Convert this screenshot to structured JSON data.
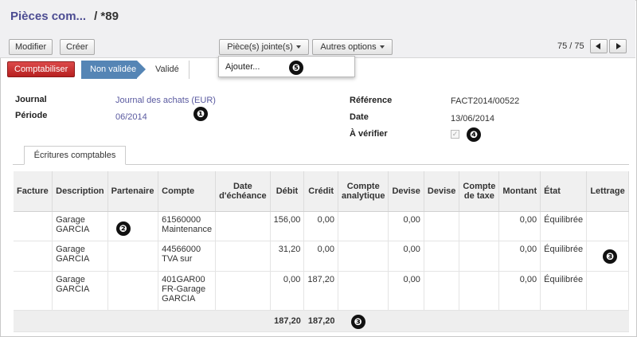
{
  "header": {
    "breadcrumb_parent": "Pièces com...",
    "breadcrumb_current": "/ *89"
  },
  "toolbar": {
    "modify_label": "Modifier",
    "create_label": "Créer",
    "attachments_label": "Pièce(s) jointe(s)",
    "more_options_label": "Autres options",
    "pager_text": "75 / 75"
  },
  "statusbar": {
    "post_label": "Comptabiliser",
    "stage_current": "Non validée",
    "stage_next": "Validé"
  },
  "dropdown": {
    "add_label": "Ajouter..."
  },
  "form": {
    "journal_label": "Journal",
    "journal_value": "Journal des achats (EUR)",
    "period_label": "Période",
    "period_value": "06/2014",
    "reference_label": "Référence",
    "reference_value": "FACT2014/00522",
    "date_label": "Date",
    "date_value": "13/06/2014",
    "to_check_label": "À vérifier",
    "to_check_value": true
  },
  "tabs": {
    "entries_label": "Écritures comptables"
  },
  "table": {
    "headers": {
      "invoice": "Facture",
      "description": "Description",
      "partner": "Partenaire",
      "account": "Compte",
      "due_date": "Date d'échéance",
      "debit": "Débit",
      "credit": "Crédit",
      "analytic": "Compte analytique",
      "currency_amount": "Devise",
      "currency": "Devise",
      "tax_account": "Compte de taxe",
      "amount": "Montant",
      "state": "État",
      "reconcile": "Lettrage"
    },
    "rows": [
      {
        "invoice": "",
        "description": "Garage GARCIA",
        "partner": "",
        "account": "61560000 Maintenance",
        "due_date": "",
        "debit": "156,00",
        "credit": "0,00",
        "analytic": "",
        "currency_amount": "0,00",
        "currency": "",
        "tax_account": "",
        "amount": "0,00",
        "state": "Équilibrée",
        "reconcile": ""
      },
      {
        "invoice": "",
        "description": "Garage GARCIA",
        "partner": "",
        "account": "44566000 TVA sur",
        "due_date": "",
        "debit": "31,20",
        "credit": "0,00",
        "analytic": "",
        "currency_amount": "0,00",
        "currency": "",
        "tax_account": "",
        "amount": "0,00",
        "state": "Équilibrée",
        "reconcile": ""
      },
      {
        "invoice": "",
        "description": "Garage GARCIA",
        "partner": "",
        "account": "401GAR00 FR-Garage GARCIA",
        "due_date": "",
        "debit": "0,00",
        "credit": "187,20",
        "analytic": "",
        "currency_amount": "0,00",
        "currency": "",
        "tax_account": "",
        "amount": "0,00",
        "state": "Équilibrée",
        "reconcile": ""
      }
    ],
    "totals": {
      "debit": "187,20",
      "credit": "187,20"
    }
  },
  "callouts": {
    "c1": "❶",
    "c2": "❷",
    "c3": "❸",
    "c4": "❹",
    "c5": "❺"
  },
  "colors": {
    "accent_link": "#5a5aa0",
    "primary_button": "#c52f2f",
    "stage_active": "#5585b5"
  }
}
